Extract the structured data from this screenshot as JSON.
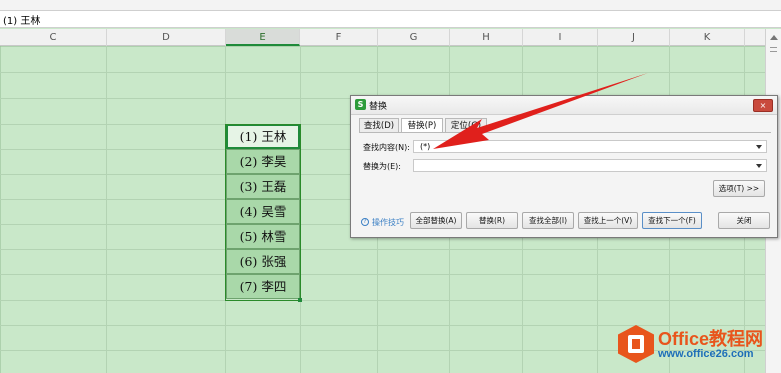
{
  "formula_bar": {
    "text": "(1) 王林"
  },
  "columns": [
    "C",
    "D",
    "E",
    "F",
    "G",
    "H",
    "I",
    "J",
    "K"
  ],
  "active_column": "E",
  "cells": [
    "(1) 王林",
    "(2) 李昊",
    "(3) 王磊",
    "(4) 吴雪",
    "(5) 林雪",
    "(6) 张强",
    "(7) 李四"
  ],
  "dialog": {
    "logo": "S",
    "title": "替换",
    "close": "×",
    "tabs": [
      "查找(D)",
      "替换(P)",
      "定位(G)"
    ],
    "active_tab": "替换(P)",
    "find_label": "查找内容(N):",
    "find_value": "(*)",
    "replace_label": "替换为(E):",
    "replace_value": "",
    "options_button": "选项(T) >>",
    "help_icon": "?",
    "help_link": "操作技巧",
    "buttons": {
      "replace_all": "全部替换(A)",
      "replace": "替换(R)",
      "find_all": "查找全部(I)",
      "find_prev": "查找上一个(V)",
      "find_next": "查找下一个(F)",
      "close": "关闭"
    }
  },
  "watermark": {
    "title": "Office教程网",
    "url": "www.office26.com"
  },
  "colors": {
    "sheet_bg": "#c9e8c9",
    "selection": "#1f8a3a",
    "arrow": "#e0201c",
    "logo_orange": "#e8551c",
    "logo_blue": "#1f6fb8"
  }
}
